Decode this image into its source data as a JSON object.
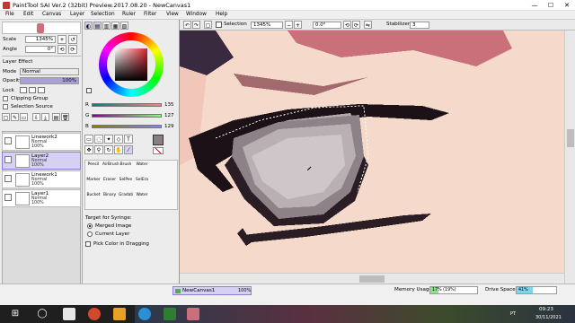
{
  "window": {
    "title": "PaintTool SAI Ver.2 (32bit) Preview.2017.08.20 - NewCanvas1",
    "min": "—",
    "max": "☐",
    "close": "✕"
  },
  "menu": [
    "File",
    "Edit",
    "Canvas",
    "Layer",
    "Selection",
    "Ruler",
    "Filter",
    "View",
    "Window",
    "Help"
  ],
  "navigator": {
    "scale_label": "Scale",
    "scale_value": "1345%",
    "angle_label": "Angle",
    "angle_value": "0°"
  },
  "layer_panel": {
    "effect_label": "Layer Effect",
    "mode_label": "Mode",
    "mode_value": "Normal",
    "opacity_label": "Opacity",
    "opacity_value": "100%",
    "lock_label": "Lock",
    "clipping_label": "Clipping Group",
    "selection_source_label": "Selection Source",
    "layers": [
      {
        "name": "Linework2",
        "mode": "Normal",
        "opacity": "100%",
        "selected": false
      },
      {
        "name": "Layer2",
        "mode": "Normal",
        "opacity": "100%",
        "selected": true
      },
      {
        "name": "Linework1",
        "mode": "Normal",
        "opacity": "100%",
        "selected": false
      },
      {
        "name": "Layer1",
        "mode": "Normal",
        "opacity": "100%",
        "selected": false
      }
    ]
  },
  "color_panel": {
    "r_label": "R",
    "r_value": "135",
    "g_label": "G",
    "g_value": "127",
    "b_label": "B",
    "b_value": "129",
    "main_color": "#877f81"
  },
  "tools": {
    "row1": [
      "Pencil",
      "AirBrush",
      "Brush",
      "Water"
    ],
    "row2": [
      "Marker",
      "Eraser",
      "SelPen",
      "SelEra"
    ],
    "row3": [
      "Bucket",
      "Binary",
      "Gradati",
      "Water"
    ]
  },
  "syringe": {
    "target_label": "Target for Syringe:",
    "merged_label": "Merged Image",
    "current_label": "Current Layer",
    "pick_dragging_label": "Pick Color in Dragging"
  },
  "canvas_toolbar": {
    "selection_label": "Selection",
    "zoom_value": "1345%",
    "angle_value": "0.0°",
    "stabilizer_label": "Stabilizer",
    "stabilizer_value": "3"
  },
  "status": {
    "canvas_tab": "NewCanvas1",
    "canvas_zoom": "100%",
    "memory_label": "Memory Usage",
    "memory_value": "17% (19%)",
    "memory_fraction": 0.17,
    "drive_label": "Drive Space",
    "drive_value": "41%",
    "drive_fraction": 0.41
  },
  "taskbar": {
    "clock_time": "09:23",
    "clock_date": "30/11/2021",
    "lang": "PT"
  }
}
